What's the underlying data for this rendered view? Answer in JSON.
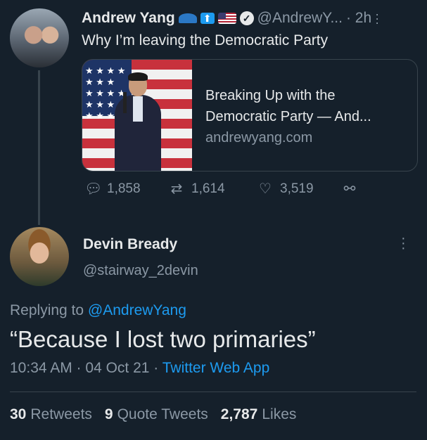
{
  "parent_tweet": {
    "author_name": "Andrew Yang",
    "handle": "@AndrewY...",
    "time": "· 2h",
    "text": "Why I’m leaving the Democratic Party",
    "card": {
      "title": "Breaking Up with the Democratic Party — And...",
      "domain": "andrewyang.com"
    },
    "actions": {
      "replies": "1,858",
      "retweets": "1,614",
      "likes": "3,519"
    }
  },
  "reply_tweet": {
    "author_name": "Devin Bready",
    "handle": "@stairway_2devin",
    "replying_label": "Replying to",
    "replying_handle": "@AndrewYang",
    "text": "“Because I lost two primaries”",
    "timestamp": "10:34 AM · 04 Oct 21 · ",
    "source": "Twitter Web App"
  },
  "stats": {
    "retweets_count": "30",
    "retweets_label": "Retweets",
    "quotes_count": "9",
    "quotes_label": "Quote Tweets",
    "likes_count": "2,787",
    "likes_label": "Likes"
  },
  "colors": {
    "background": "#15202b",
    "text": "#e7e9ea",
    "muted": "#8b98a5",
    "accent": "#1d9bf0"
  }
}
